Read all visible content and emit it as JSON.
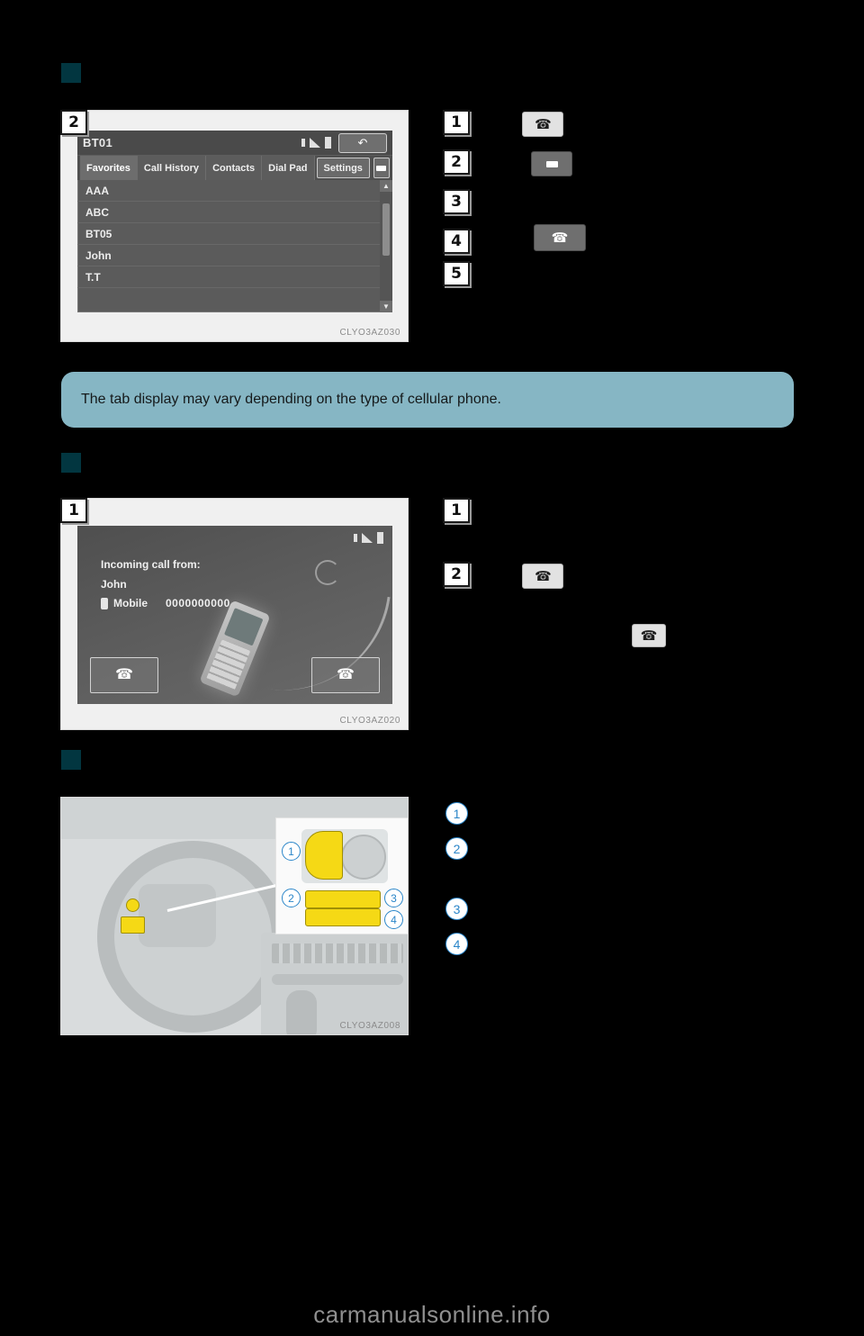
{
  "page": {
    "background": "#000000",
    "accent_teal": "#023640",
    "callout_blue": "#86b6c4",
    "callout_number_blue": "#2b86c9",
    "watermark": "carmanualsonline.info"
  },
  "sections": [
    {
      "id": "phone-list",
      "heading": "",
      "figure": {
        "step_badge": "2",
        "caption": "CLYO3AZ030",
        "screen": {
          "title": "BT01",
          "status_icons": [
            "bluetooth-icon",
            "signal-icon",
            "battery-icon"
          ],
          "back_button": "back-arrow-icon",
          "tabs": [
            {
              "label": "Favorites",
              "active": true
            },
            {
              "label": "Call History",
              "active": false
            },
            {
              "label": "Contacts",
              "active": false
            },
            {
              "label": "Dial Pad",
              "active": false
            },
            {
              "label": "Settings",
              "active": false
            }
          ],
          "tab_extra_icon": "handset-icon",
          "list_items": [
            "AAA",
            "ABC",
            "BT05",
            "John",
            "T.T"
          ],
          "scroll_up": "▲",
          "scroll_down": "▼"
        }
      },
      "items": [
        {
          "badge": "1",
          "text": "",
          "icon": "phone-off-hook-icon",
          "icon_style": "sq"
        },
        {
          "badge": "2",
          "text": "",
          "icon": "handset-bar-icon",
          "icon_style": "sq-dark"
        },
        {
          "badge": "3",
          "text": "",
          "icon": "",
          "icon_style": ""
        },
        {
          "badge": "4",
          "text": "",
          "icon": "phone-handset-icon",
          "icon_style": "wide-dark"
        },
        {
          "badge": "5",
          "text": "",
          "icon": "",
          "icon_style": ""
        }
      ]
    },
    {
      "id": "incoming-call",
      "heading": "",
      "figure": {
        "step_badge": "1",
        "caption": "CLYO3AZ020",
        "screen": {
          "status_icons": [
            "bluetooth-icon",
            "signal-icon",
            "battery-icon"
          ],
          "line1": "Incoming call from:",
          "line2": "John",
          "label_mobile": "Mobile",
          "number": "0000000000",
          "answer_button": "answer-call-icon",
          "reject_button": "end-call-icon"
        }
      },
      "items": [
        {
          "badge": "1",
          "text": "",
          "icon": "",
          "icon_style": ""
        },
        {
          "badge": "2",
          "text": "",
          "icon": "phone-off-hook-icon",
          "icon_style": "sq"
        }
      ],
      "extra_icon": "phone-hangup-icon"
    },
    {
      "id": "steering-wheel-switches",
      "heading": "",
      "figure": {
        "caption": "CLYO3AZ008",
        "callouts": [
          "1",
          "2",
          "3",
          "4"
        ]
      },
      "items": [
        {
          "badge": "1",
          "text": ""
        },
        {
          "badge": "2",
          "text": ""
        },
        {
          "badge": "3",
          "text": ""
        },
        {
          "badge": "4",
          "text": ""
        }
      ]
    }
  ],
  "info_callout": {
    "text": "The tab display may vary depending on the type of cellular phone."
  }
}
